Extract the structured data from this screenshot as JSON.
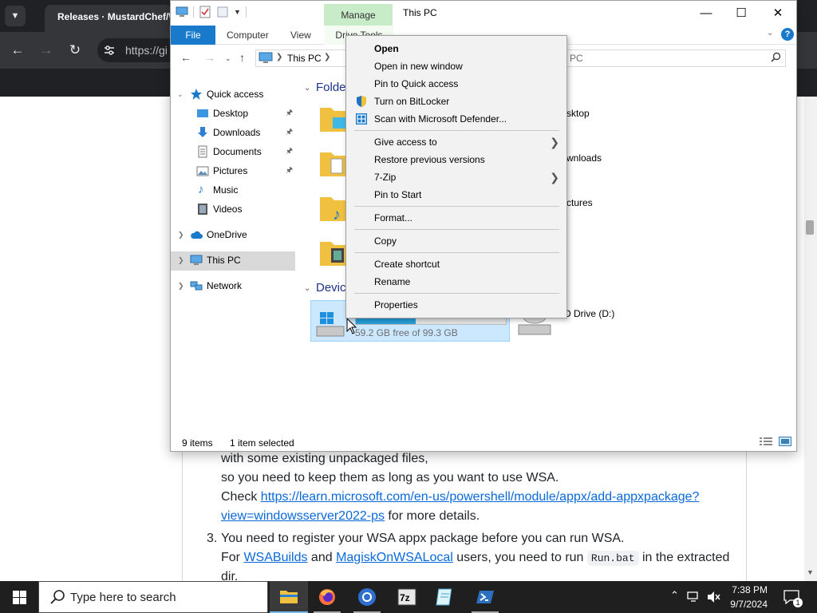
{
  "browser": {
    "tab_title": "Releases · MustardChef/W",
    "url": "https://gi"
  },
  "page": {
    "line1": "with some existing unpackaged files,",
    "line2": "so you need to keep them as long as you want to use WSA.",
    "line3_prefix": "Check ",
    "line3_link": "https://learn.microsoft.com/en-us/powershell/module/appx/add-appxpackage?",
    "line4_link": "view=windowsserver2022-ps",
    "line4_suffix": " for more details.",
    "step_num": "3.",
    "line5": "You need to register your WSA appx package before you can run WSA.",
    "line6_for": "For ",
    "line6_link1": "WSABuilds",
    "line6_and": " and ",
    "line6_link2": "MagiskOnWSALocal",
    "line6_mid": " users, you need to run ",
    "line6_code": "Run.bat",
    "line6_end": " in the extracted",
    "line7": "dir."
  },
  "explorer": {
    "manage_tab": "Manage",
    "window_title": "This PC",
    "ribbon": {
      "file": "File",
      "computer": "Computer",
      "view": "View",
      "drive_tools": "Drive Tools"
    },
    "address": "This PC",
    "search_placeholder": "PC",
    "nav": {
      "quick_access": "Quick access",
      "desktop": "Desktop",
      "downloads": "Downloads",
      "documents": "Documents",
      "pictures": "Pictures",
      "music": "Music",
      "videos": "Videos",
      "onedrive": "OneDrive",
      "this_pc": "This PC",
      "network": "Network"
    },
    "content": {
      "folders_header": "Folde",
      "devices_header": "Devic",
      "desktop_name": "sktop",
      "downloads_name": "wnloads",
      "pictures_name": "ctures",
      "drive_c_free": "59.2 GB free of 99.3 GB",
      "drive_c_used_fraction": 0.4,
      "drive_d_name": "D Drive (D:)"
    },
    "status": {
      "items": "9 items",
      "selected": "1 item selected"
    }
  },
  "context_menu": {
    "open": "Open",
    "open_new_window": "Open in new window",
    "pin_quick_access": "Pin to Quick access",
    "bitlocker": "Turn on BitLocker",
    "defender": "Scan with Microsoft Defender...",
    "give_access": "Give access to",
    "restore": "Restore previous versions",
    "sevenzip": "7-Zip",
    "pin_start": "Pin to Start",
    "format": "Format...",
    "copy": "Copy",
    "create_shortcut": "Create shortcut",
    "rename": "Rename",
    "properties": "Properties"
  },
  "taskbar": {
    "search_placeholder": "Type here to search",
    "time": "7:38 PM",
    "date": "9/7/2024",
    "notification_count": "1"
  }
}
